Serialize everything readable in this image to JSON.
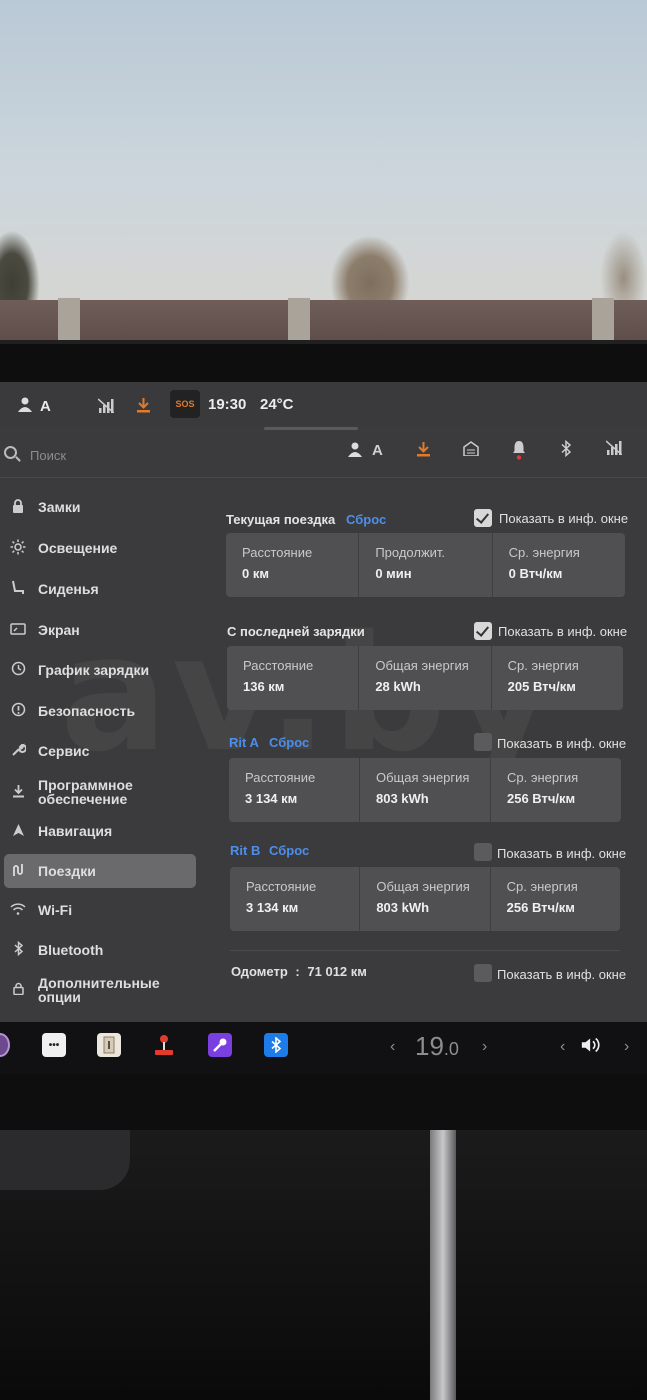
{
  "statusbar": {
    "profile": "A",
    "time": "19:30",
    "temperature": "24°C",
    "sos": "SOS"
  },
  "topbar": {
    "search_placeholder": "Поиск",
    "profile": "A"
  },
  "sidebar": {
    "items": [
      {
        "label": "Замки",
        "icon": "lock-icon"
      },
      {
        "label": "Освещение",
        "icon": "light-icon"
      },
      {
        "label": "Сиденья",
        "icon": "seat-icon"
      },
      {
        "label": "Экран",
        "icon": "display-icon"
      },
      {
        "label": "График зарядки",
        "icon": "schedule-icon"
      },
      {
        "label": "Безопасность",
        "icon": "safety-icon"
      },
      {
        "label": "Сервис",
        "icon": "wrench-icon"
      },
      {
        "label": "Программное обеспечение",
        "icon": "download-icon"
      },
      {
        "label": "Навигация",
        "icon": "navigation-icon"
      },
      {
        "label": "Поездки",
        "icon": "trips-icon",
        "active": true
      },
      {
        "label": "Wi-Fi",
        "icon": "wifi-icon"
      },
      {
        "label": "Bluetooth",
        "icon": "bluetooth-icon"
      },
      {
        "label": "Дополнительные опции",
        "icon": "lock-small-icon"
      }
    ]
  },
  "main": {
    "show_in_window": "Показать в инф. окне",
    "current_trip": {
      "title": "Текущая поездка",
      "reset": "Сброс",
      "checked": true,
      "cells": [
        {
          "label": "Расстояние",
          "value": "0 км"
        },
        {
          "label": "Продолжит.",
          "value": "0 мин"
        },
        {
          "label": "Ср. энергия",
          "value": "0 Втч/км"
        }
      ]
    },
    "since_charge": {
      "title": "С последней зарядки",
      "checked": true,
      "cells": [
        {
          "label": "Расстояние",
          "value": "136 км"
        },
        {
          "label": "Общая энергия",
          "value": "28 kWh"
        },
        {
          "label": "Ср. энергия",
          "value": "205 Втч/км"
        }
      ]
    },
    "trip_a": {
      "title": "Rit A",
      "reset": "Сброс",
      "checked": false,
      "cells": [
        {
          "label": "Расстояние",
          "value": "3 134 км"
        },
        {
          "label": "Общая энергия",
          "value": "803 kWh"
        },
        {
          "label": "Ср. энергия",
          "value": "256 Втч/км"
        }
      ]
    },
    "trip_b": {
      "title": "Rit B",
      "reset": "Сброс",
      "checked": false,
      "cells": [
        {
          "label": "Расстояние",
          "value": "3 134 км"
        },
        {
          "label": "Общая энергия",
          "value": "803 kWh"
        },
        {
          "label": "Ср. энергия",
          "value": "256 Втч/км"
        }
      ]
    },
    "odometer": {
      "label": "Одометр",
      "separator": ":",
      "value": "71 012 км",
      "checked": false
    }
  },
  "watermark": "av.by",
  "dock": {
    "dots_label": "•••",
    "temperature": "19",
    "temperature_decimal": ".0",
    "left_arrow": "‹",
    "right_arrow": "›"
  },
  "colors": {
    "accent": "#4d8ee8",
    "orange": "#e27a2a",
    "notification": "#e0353b"
  }
}
